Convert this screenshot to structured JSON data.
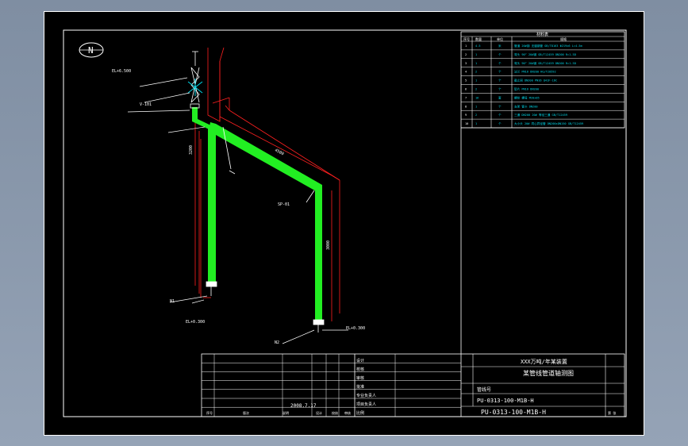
{
  "drawing": {
    "north_symbol": "N",
    "parts_table": {
      "title": "材料表",
      "headers": [
        "序号",
        "数量",
        "单位",
        "规格"
      ],
      "rows": [
        {
          "no": "1",
          "qty": "4.5",
          "unit": "米",
          "desc": "管道 20#钢 无缝钢管 GB/T8163 Φ219x6 L=4.5m"
        },
        {
          "no": "2",
          "qty": "1",
          "unit": "个",
          "desc": "弯头 90° 20#钢 GB/T12459 DN200 R=1.5D"
        },
        {
          "no": "3",
          "qty": "1",
          "unit": "个",
          "desc": "弯头 90° 20#钢 GB/T12459 DN200 R=1.5D"
        },
        {
          "no": "4",
          "qty": "2",
          "unit": "个",
          "desc": "法兰 PN16 DN200 HG/T20592"
        },
        {
          "no": "5",
          "qty": "1",
          "unit": "个",
          "desc": "截止阀 DN200 PN16 Q41F-16C"
        },
        {
          "no": "6",
          "qty": "2",
          "unit": "个",
          "desc": "垫片 PN16 DN200"
        },
        {
          "no": "7",
          "qty": "16",
          "unit": "套",
          "desc": "螺栓 螺母 M20x85"
        },
        {
          "no": "8",
          "qty": "1",
          "unit": "个",
          "desc": "支架 管卡 DN200"
        },
        {
          "no": "9",
          "qty": "2",
          "unit": "个",
          "desc": "三通 DN200 20# 等径三通 GB/T12459"
        },
        {
          "no": "10",
          "qty": "1",
          "unit": "个",
          "desc": "大小头 20# 同心异径管 DN200xDN150 GB/T12459"
        }
      ]
    },
    "title_block": {
      "project_line": "XXX万吨/年某装置",
      "drawing_name": "某管线管道轴测图",
      "line_no_label": "管线号",
      "line_number": "PU-0313-100-M1B-H",
      "stamp_number": "PU-0313-100-M1B-H",
      "date": "2008.7.17",
      "labels": [
        "设计",
        "校核",
        "审核",
        "批准",
        "专业负责人",
        "项目负责人"
      ],
      "scale_label": "比例",
      "sheet_label": "第 张",
      "col_labels": [
        "序号",
        "版次",
        "说明",
        "设计",
        "校核",
        "审核"
      ]
    },
    "labels": {
      "elev_top": "EL+6.500",
      "elev_bottom_left": "EL+0.300",
      "elev_bottom_right": "EL+0.300",
      "dim_horizontal": "4500",
      "dim_vertical_left": "3200",
      "dim_vertical_right": "3000",
      "nozzle_left": "N1",
      "nozzle_right": "N2",
      "valve_tag": "V-101",
      "support_tag": "SP-01"
    }
  }
}
